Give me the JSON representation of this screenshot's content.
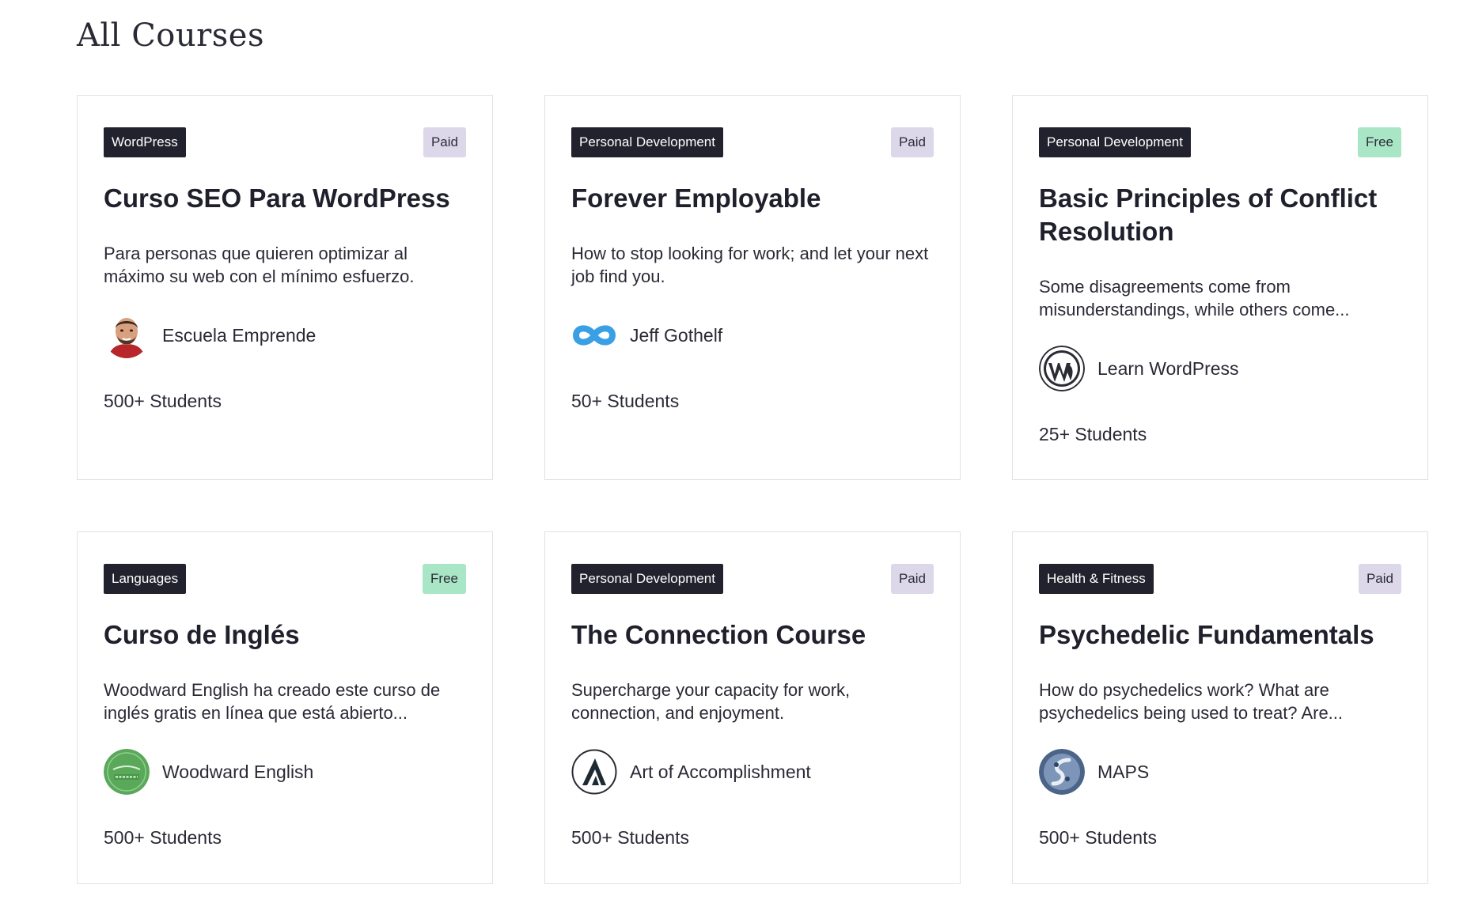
{
  "page": {
    "title": "All Courses"
  },
  "courses": [
    {
      "category": "WordPress",
      "price": "Paid",
      "price_type": "paid",
      "title": "Curso SEO Para WordPress",
      "description": "Para personas que quieren optimizar al máximo su web con el mínimo esfuerzo.",
      "author": "Escuela Emprende",
      "author_icon": "person-photo-icon",
      "students": "500+ Students"
    },
    {
      "category": "Personal Development",
      "price": "Paid",
      "price_type": "paid",
      "title": "Forever Employable",
      "description": "How to stop looking for work; and let your next job find you.",
      "author": "Jeff Gothelf",
      "author_icon": "infinity-logo-icon",
      "students": "50+ Students"
    },
    {
      "category": "Personal Development",
      "price": "Free",
      "price_type": "free",
      "title": "Basic Principles of Conflict Resolution",
      "description": "Some disagreements come from misunderstandings, while others come...",
      "author": "Learn WordPress",
      "author_icon": "wordpress-logo-icon",
      "students": "25+ Students"
    },
    {
      "category": "Languages",
      "price": "Free",
      "price_type": "free",
      "title": "Curso de Inglés",
      "description": "Woodward English ha creado este curso de inglés gratis en línea que está abierto...",
      "author": "Woodward English",
      "author_icon": "woodward-english-logo-icon",
      "students": "500+ Students"
    },
    {
      "category": "Personal Development",
      "price": "Paid",
      "price_type": "paid",
      "title": "The Connection Course",
      "description": "Supercharge your capacity for work, connection, and enjoyment.",
      "author": "Art of Accomplishment",
      "author_icon": "triangle-a-logo-icon",
      "students": "500+ Students"
    },
    {
      "category": "Health & Fitness",
      "price": "Paid",
      "price_type": "paid",
      "title": "Psychedelic Fundamentals",
      "description": "How do psychedelics work? What are psychedelics being used to treat? Are...",
      "author": "MAPS",
      "author_icon": "maps-logo-icon",
      "students": "500+ Students"
    }
  ],
  "colors": {
    "category_bg": "#22222e",
    "paid_bg": "#dcd8ea",
    "free_bg": "#a8e6c6",
    "border": "#e2e2e6"
  }
}
